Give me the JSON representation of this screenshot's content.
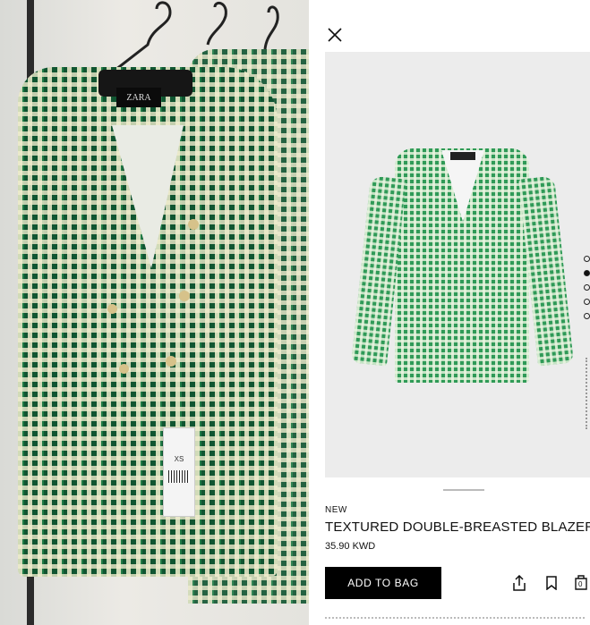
{
  "header": {
    "close_icon": "close-icon"
  },
  "product": {
    "badge": "NEW",
    "title": "TEXTURED DOUBLE-BREASTED BLAZER",
    "price": "35.90 KWD",
    "add_to_bag_label": "ADD TO BAG",
    "brand_label": "ZARA",
    "size_tag": "XS"
  },
  "gallery": {
    "dot_count": 5,
    "active_index": 1
  },
  "actions": {
    "share_icon": "share-icon",
    "bookmark_icon": "bookmark-icon",
    "bag_icon": "bag-icon",
    "bag_count": "0"
  },
  "colors": {
    "accent": "#000000",
    "tweed_green": "#1f7a45"
  }
}
